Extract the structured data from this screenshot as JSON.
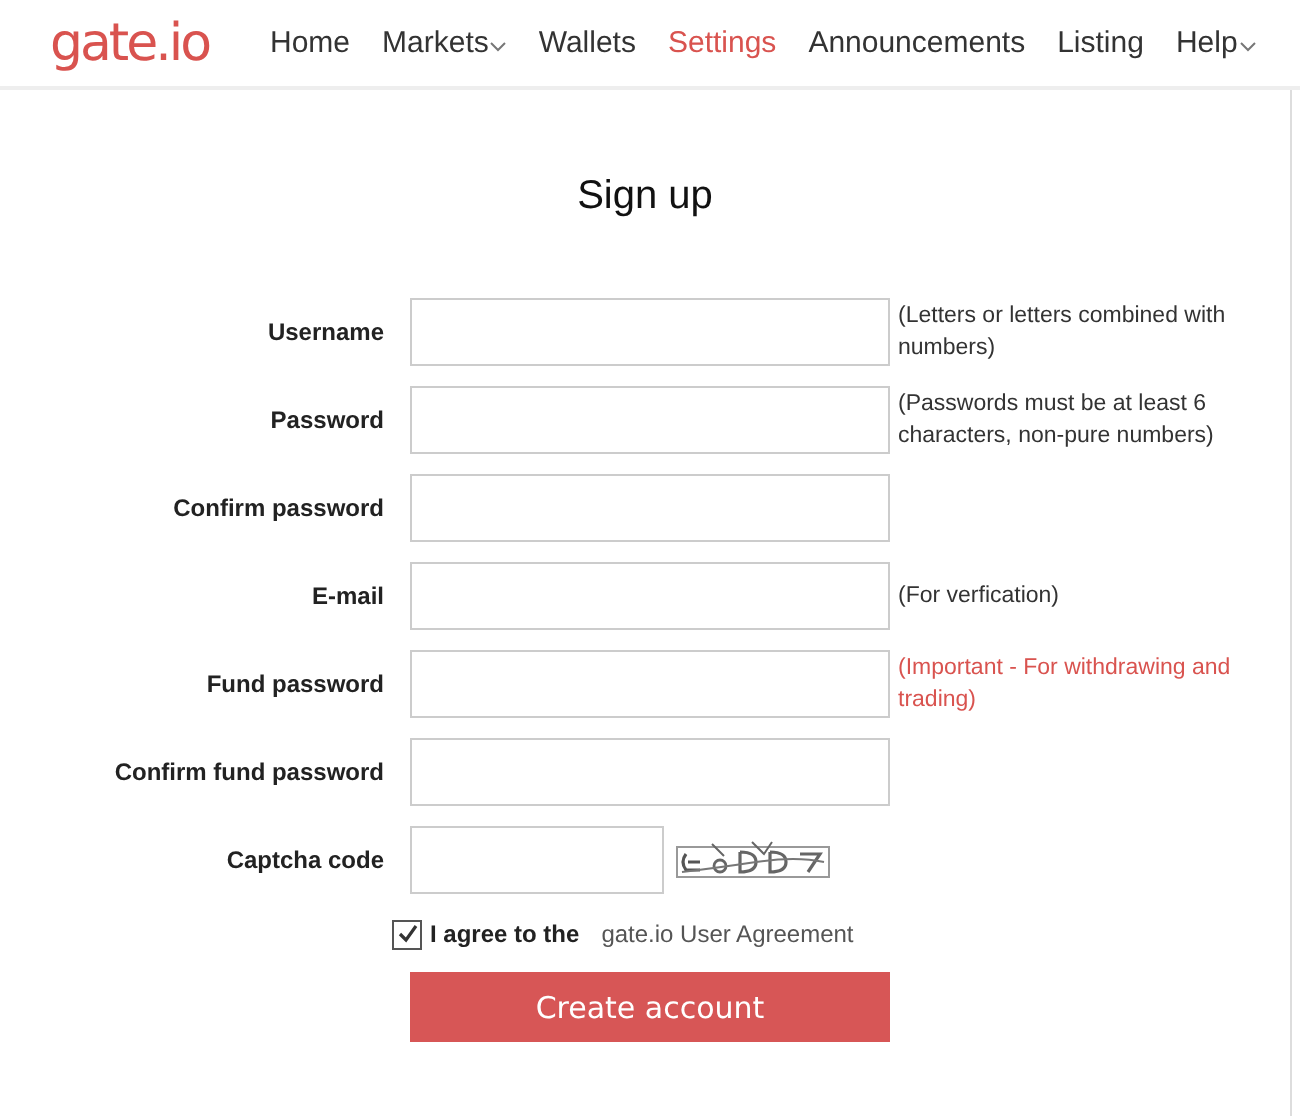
{
  "logo": "gate.io",
  "nav": [
    {
      "label": "Home",
      "selected": false,
      "dropdown": false
    },
    {
      "label": "Markets",
      "selected": false,
      "dropdown": true
    },
    {
      "label": "Wallets",
      "selected": false,
      "dropdown": false
    },
    {
      "label": "Settings",
      "selected": true,
      "dropdown": false
    },
    {
      "label": "Announcements",
      "selected": false,
      "dropdown": false
    },
    {
      "label": "Listing",
      "selected": false,
      "dropdown": false
    },
    {
      "label": "Help",
      "selected": false,
      "dropdown": true
    }
  ],
  "title": "Sign up",
  "fields": [
    {
      "kind": "text",
      "label": "Username",
      "hint": "(Letters or letters combined with numbers)",
      "important": false
    },
    {
      "kind": "text",
      "label": "Password",
      "hint": "(Passwords must be at least 6 characters, non-pure numbers)",
      "important": false
    },
    {
      "kind": "text",
      "label": "Confirm password"
    },
    {
      "kind": "text",
      "label": "E-mail",
      "hint": "(For verfication)",
      "important": false
    },
    {
      "kind": "text",
      "label": "Fund password",
      "hint": "(Important - For withdrawing and trading)",
      "important": true
    },
    {
      "kind": "text",
      "label": "Confirm fund password"
    },
    {
      "kind": "captcha",
      "label": "Captcha code"
    }
  ],
  "agree": {
    "checked": true,
    "label": "I agree to the",
    "link": "gate.io User Agreement"
  },
  "submit": "Create account"
}
